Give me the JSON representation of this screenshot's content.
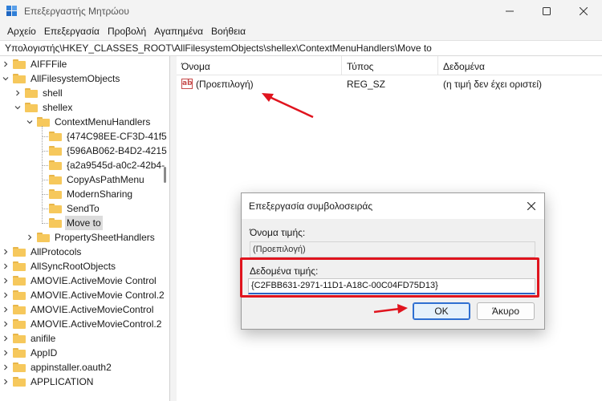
{
  "window": {
    "title": "Επεξεργαστής Μητρώου",
    "minimize_icon": "minimize-icon",
    "maximize_icon": "maximize-icon",
    "close_icon": "close-icon"
  },
  "menu": {
    "items": [
      "Αρχείο",
      "Επεξεργασία",
      "Προβολή",
      "Αγαπημένα",
      "Βοήθεια"
    ]
  },
  "address": {
    "path": "Υπολογιστής\\HKEY_CLASSES_ROOT\\AllFilesystemObjects\\shellex\\ContextMenuHandlers\\Move to"
  },
  "tree": {
    "items": [
      {
        "label": "AIFFFile",
        "expanded": false
      },
      {
        "label": "AllFilesystemObjects",
        "expanded": true
      },
      {
        "label": "shell",
        "expanded": false
      },
      {
        "label": "shellex",
        "expanded": true
      },
      {
        "label": "ContextMenuHandlers",
        "expanded": true
      },
      {
        "label": "{474C98EE-CF3D-41f5"
      },
      {
        "label": "{596AB062-B4D2-4215"
      },
      {
        "label": "{a2a9545d-a0c2-42b4-"
      },
      {
        "label": "CopyAsPathMenu"
      },
      {
        "label": "ModernSharing"
      },
      {
        "label": "SendTo"
      },
      {
        "label": "Move to",
        "selected": true
      },
      {
        "label": "PropertySheetHandlers",
        "expanded": false
      },
      {
        "label": "AllProtocols",
        "expanded": false
      },
      {
        "label": "AllSyncRootObjects",
        "expanded": false
      },
      {
        "label": "AMOVIE.ActiveMovie Control",
        "expanded": false
      },
      {
        "label": "AMOVIE.ActiveMovie Control.2",
        "expanded": false
      },
      {
        "label": "AMOVIE.ActiveMovieControl",
        "expanded": false
      },
      {
        "label": "AMOVIE.ActiveMovieControl.2",
        "expanded": false
      },
      {
        "label": "anifile",
        "expanded": false
      },
      {
        "label": "AppID",
        "expanded": false
      },
      {
        "label": "appinstaller.oauth2",
        "expanded": false
      },
      {
        "label": "APPLICATION",
        "expanded": false
      }
    ]
  },
  "list": {
    "columns": [
      "Όνομα",
      "Τύπος",
      "Δεδομένα"
    ],
    "rows": [
      {
        "icon": "string-value-icon",
        "icon_text": "ab",
        "name": "(Προεπιλογή)",
        "type": "REG_SZ",
        "data": "(η τιμή δεν έχει οριστεί)"
      }
    ]
  },
  "dialog": {
    "title": "Επεξεργασία συμβολοσειράς",
    "value_name_label": "Όνομα τιμής:",
    "value_name": "(Προεπιλογή)",
    "value_data_label": "Δεδομένα τιμής:",
    "value_data": "{C2FBB631-2971-11D1-A18C-00C04FD75D13}",
    "ok_label": "OK",
    "cancel_label": "Άκυρο"
  },
  "colors": {
    "annotation": "#e0141e",
    "folder": "#f6c85c",
    "accent": "#2e6fd1"
  }
}
